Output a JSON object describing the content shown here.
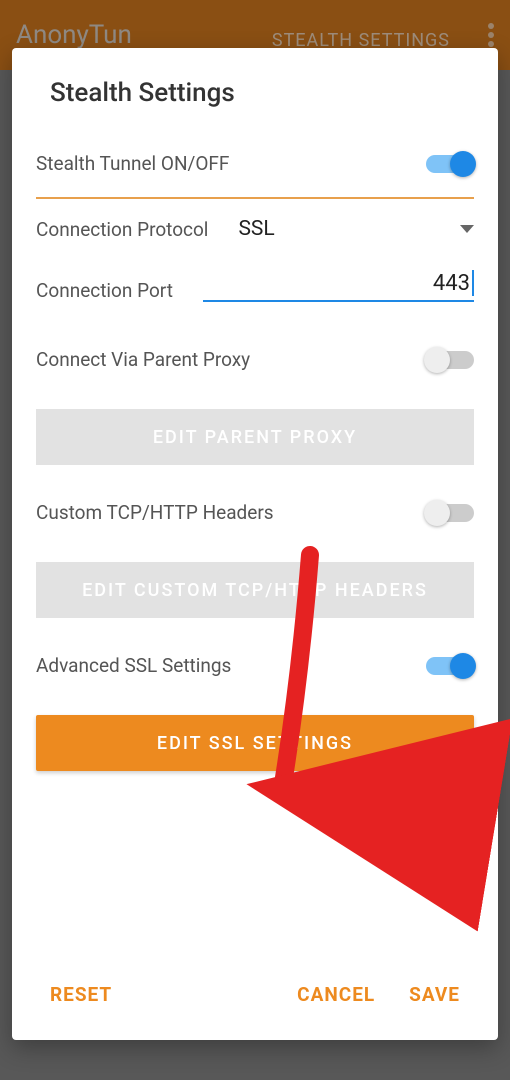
{
  "background": {
    "app_title": "AnonyTun",
    "header_action": "STEALTH SETTINGS"
  },
  "modal": {
    "title": "Stealth Settings",
    "stealth_tunnel": {
      "label": "Stealth Tunnel ON/OFF",
      "on": true
    },
    "protocol": {
      "label": "Connection Protocol",
      "value": "SSL"
    },
    "port": {
      "label": "Connection Port",
      "value": "443"
    },
    "parent_proxy": {
      "label": "Connect Via Parent Proxy",
      "on": false
    },
    "edit_parent_proxy_btn": "EDIT PARENT PROXY",
    "custom_headers": {
      "label": "Custom TCP/HTTP Headers",
      "on": false
    },
    "edit_headers_btn": "EDIT CUSTOM TCP/HTTP HEADERS",
    "advanced_ssl": {
      "label": "Advanced SSL Settings",
      "on": true
    },
    "edit_ssl_btn": "EDIT SSL SETTINGS",
    "footer": {
      "reset": "RESET",
      "cancel": "CANCEL",
      "save": "SAVE"
    }
  },
  "colors": {
    "accent": "#ed8a1f",
    "blue": "#1e88e5"
  }
}
